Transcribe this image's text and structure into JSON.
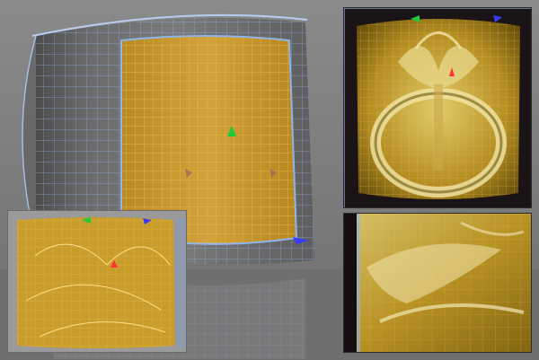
{
  "viewer": {
    "colors": {
      "background": "#7c7c7c",
      "wire_blue": "#8fb4e8",
      "wire_orange": "#ffae3a",
      "selection_fill": "#c69a2b",
      "gold_dark": "#5c4a0a",
      "gold_light": "#e6d27a",
      "gizmo_green": "#1ecb3a",
      "gizmo_blue": "#3a3aff",
      "gizmo_red": "#ff3030"
    },
    "panels": [
      {
        "id": "main-viewport",
        "icon": "move-gizmo-icon"
      },
      {
        "id": "sculpt-preview-top",
        "icon": "move-gizmo-icon"
      },
      {
        "id": "sculpt-closeup",
        "icon": ""
      },
      {
        "id": "uv-wire-preview",
        "icon": "move-gizmo-icon"
      }
    ]
  }
}
